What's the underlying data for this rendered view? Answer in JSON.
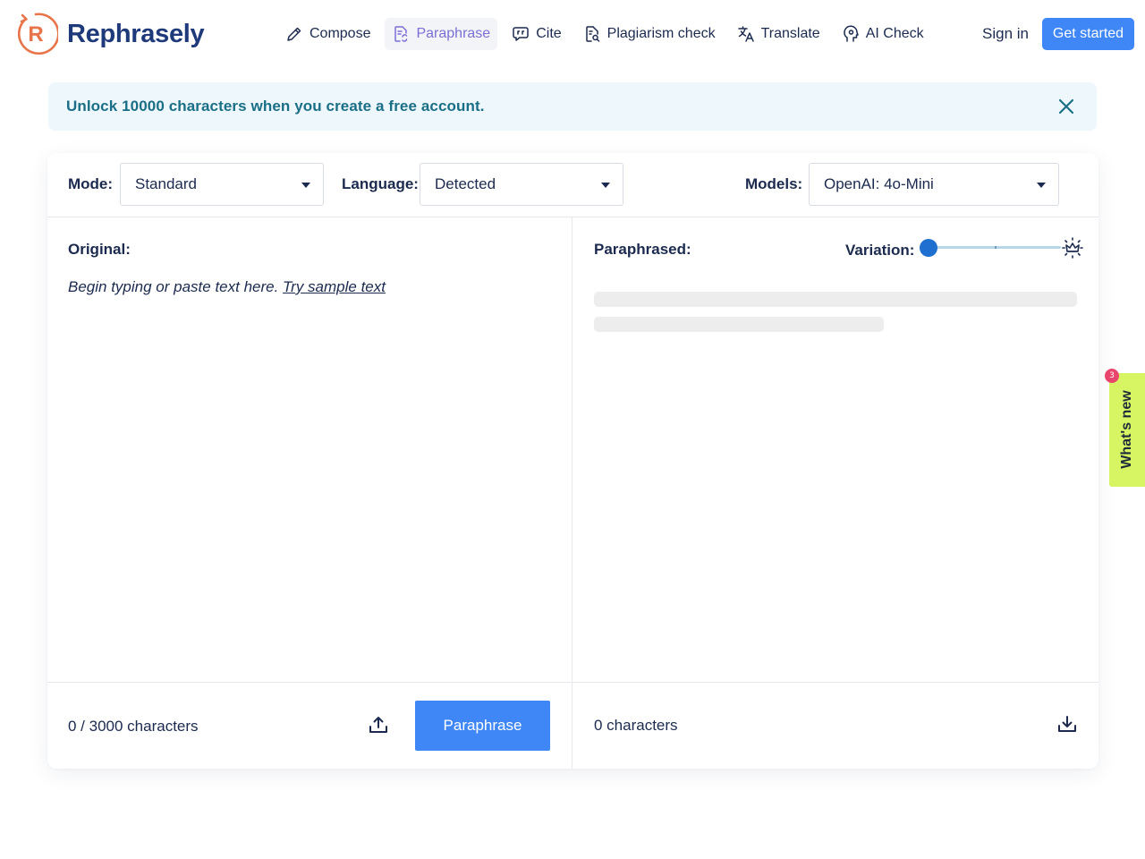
{
  "brand": {
    "name": "Rephrasely",
    "mark_letter": "R",
    "color": "#1f3a7a",
    "mark_color": "#e8744a"
  },
  "nav": {
    "items": [
      {
        "label": "Compose",
        "icon": "pencil-icon",
        "active": false
      },
      {
        "label": "Paraphrase",
        "icon": "paraphrase-icon",
        "active": true
      },
      {
        "label": "Cite",
        "icon": "quote-icon",
        "active": false
      },
      {
        "label": "Plagiarism check",
        "icon": "document-search-icon",
        "active": false
      },
      {
        "label": "Translate",
        "icon": "translate-icon",
        "active": false
      },
      {
        "label": "AI Check",
        "icon": "ai-head-icon",
        "active": false
      }
    ],
    "signin": "Sign in",
    "get_started": "Get started",
    "accent": "#3f86f6"
  },
  "banner": {
    "text": "Unlock 10000 characters when you create a free account.",
    "close_icon": "close-icon"
  },
  "toolbar": {
    "mode_label": "Mode:",
    "mode_value": "Standard",
    "language_label": "Language:",
    "language_value": "Detected",
    "models_label": "Models:",
    "models_value": "OpenAI: 4o-Mini"
  },
  "original": {
    "title": "Original:",
    "placeholder": "Begin typing or paste text here.",
    "sample_link": "Try sample text",
    "count": "0 / 3000 characters",
    "upload_icon": "upload-icon",
    "button": "Paraphrase"
  },
  "paraphrased": {
    "title": "Paraphrased:",
    "variation_label": "Variation:",
    "variation_level": 0,
    "premium_icon": "crown-icon",
    "count": "0 characters",
    "download_icon": "download-icon"
  },
  "whats_new": {
    "label": "What's new",
    "badge": "3",
    "color": "#d7f562"
  }
}
